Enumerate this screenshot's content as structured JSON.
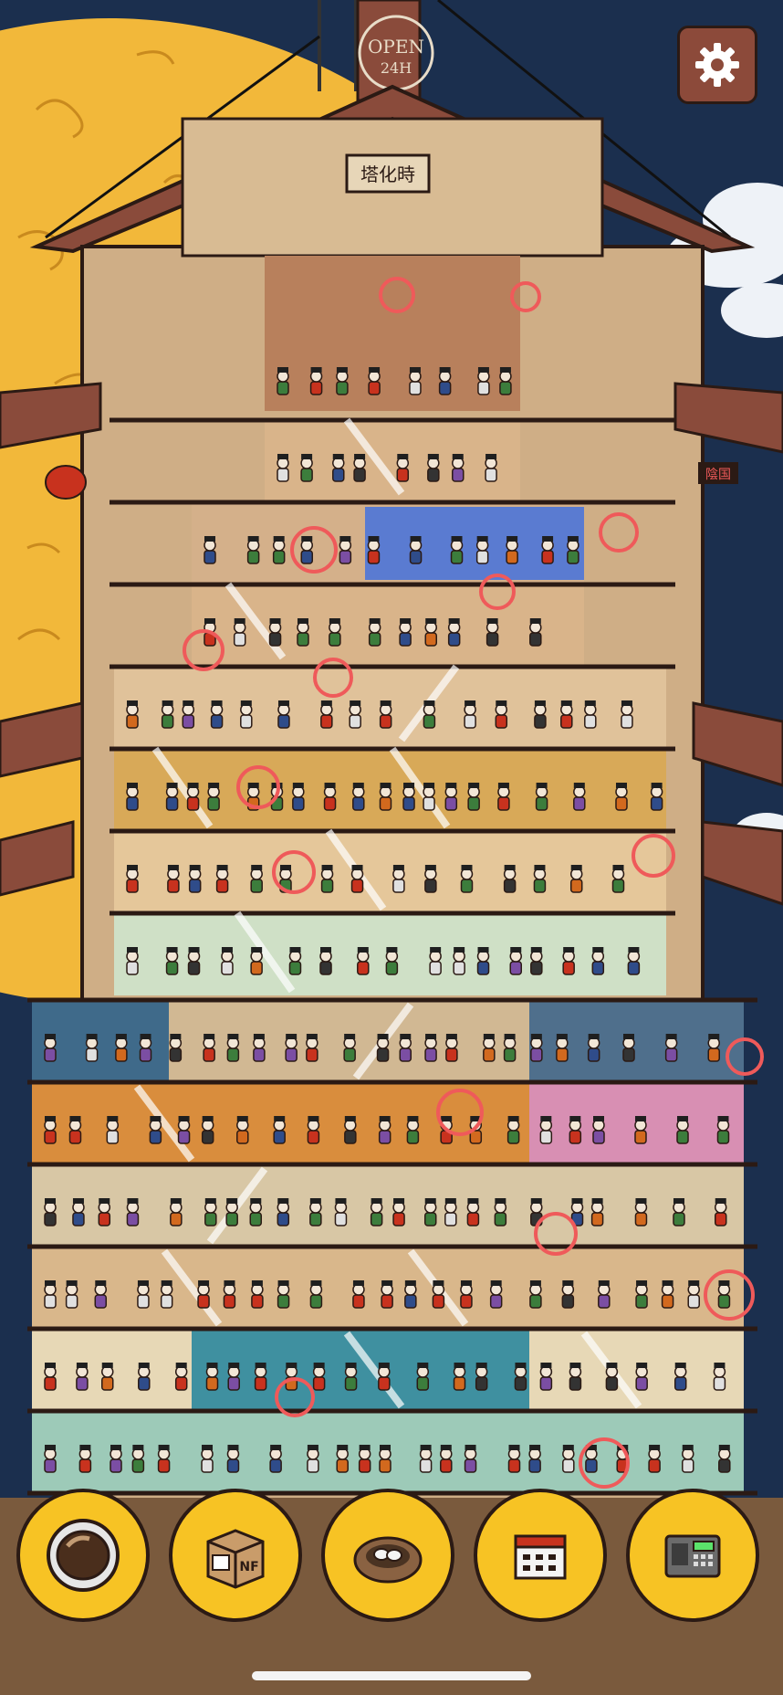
{
  "game": {
    "sign_open": "OPEN",
    "sign_hours": "24H",
    "top_plaque": "塔化時",
    "side_plaque": "陰国",
    "box_label": "NF"
  },
  "hud": {
    "settings_icon": "gear-icon"
  },
  "toolbar": {
    "buttons": [
      {
        "icon": "astronaut-helmet-icon"
      },
      {
        "icon": "package-box-icon"
      },
      {
        "icon": "nest-eggs-icon"
      },
      {
        "icon": "calendar-icon"
      },
      {
        "icon": "safe-keypad-icon"
      }
    ]
  },
  "hidden_object_markers": {
    "count": 19,
    "color": "#ef5a5a"
  },
  "colors": {
    "night_sky": "#1b2f4e",
    "moon": "#f2b83a",
    "roof": "#8a4b3b",
    "wood": "#cfae86",
    "button_yellow": "#f7c324",
    "marker_red": "#ef5a5a"
  }
}
